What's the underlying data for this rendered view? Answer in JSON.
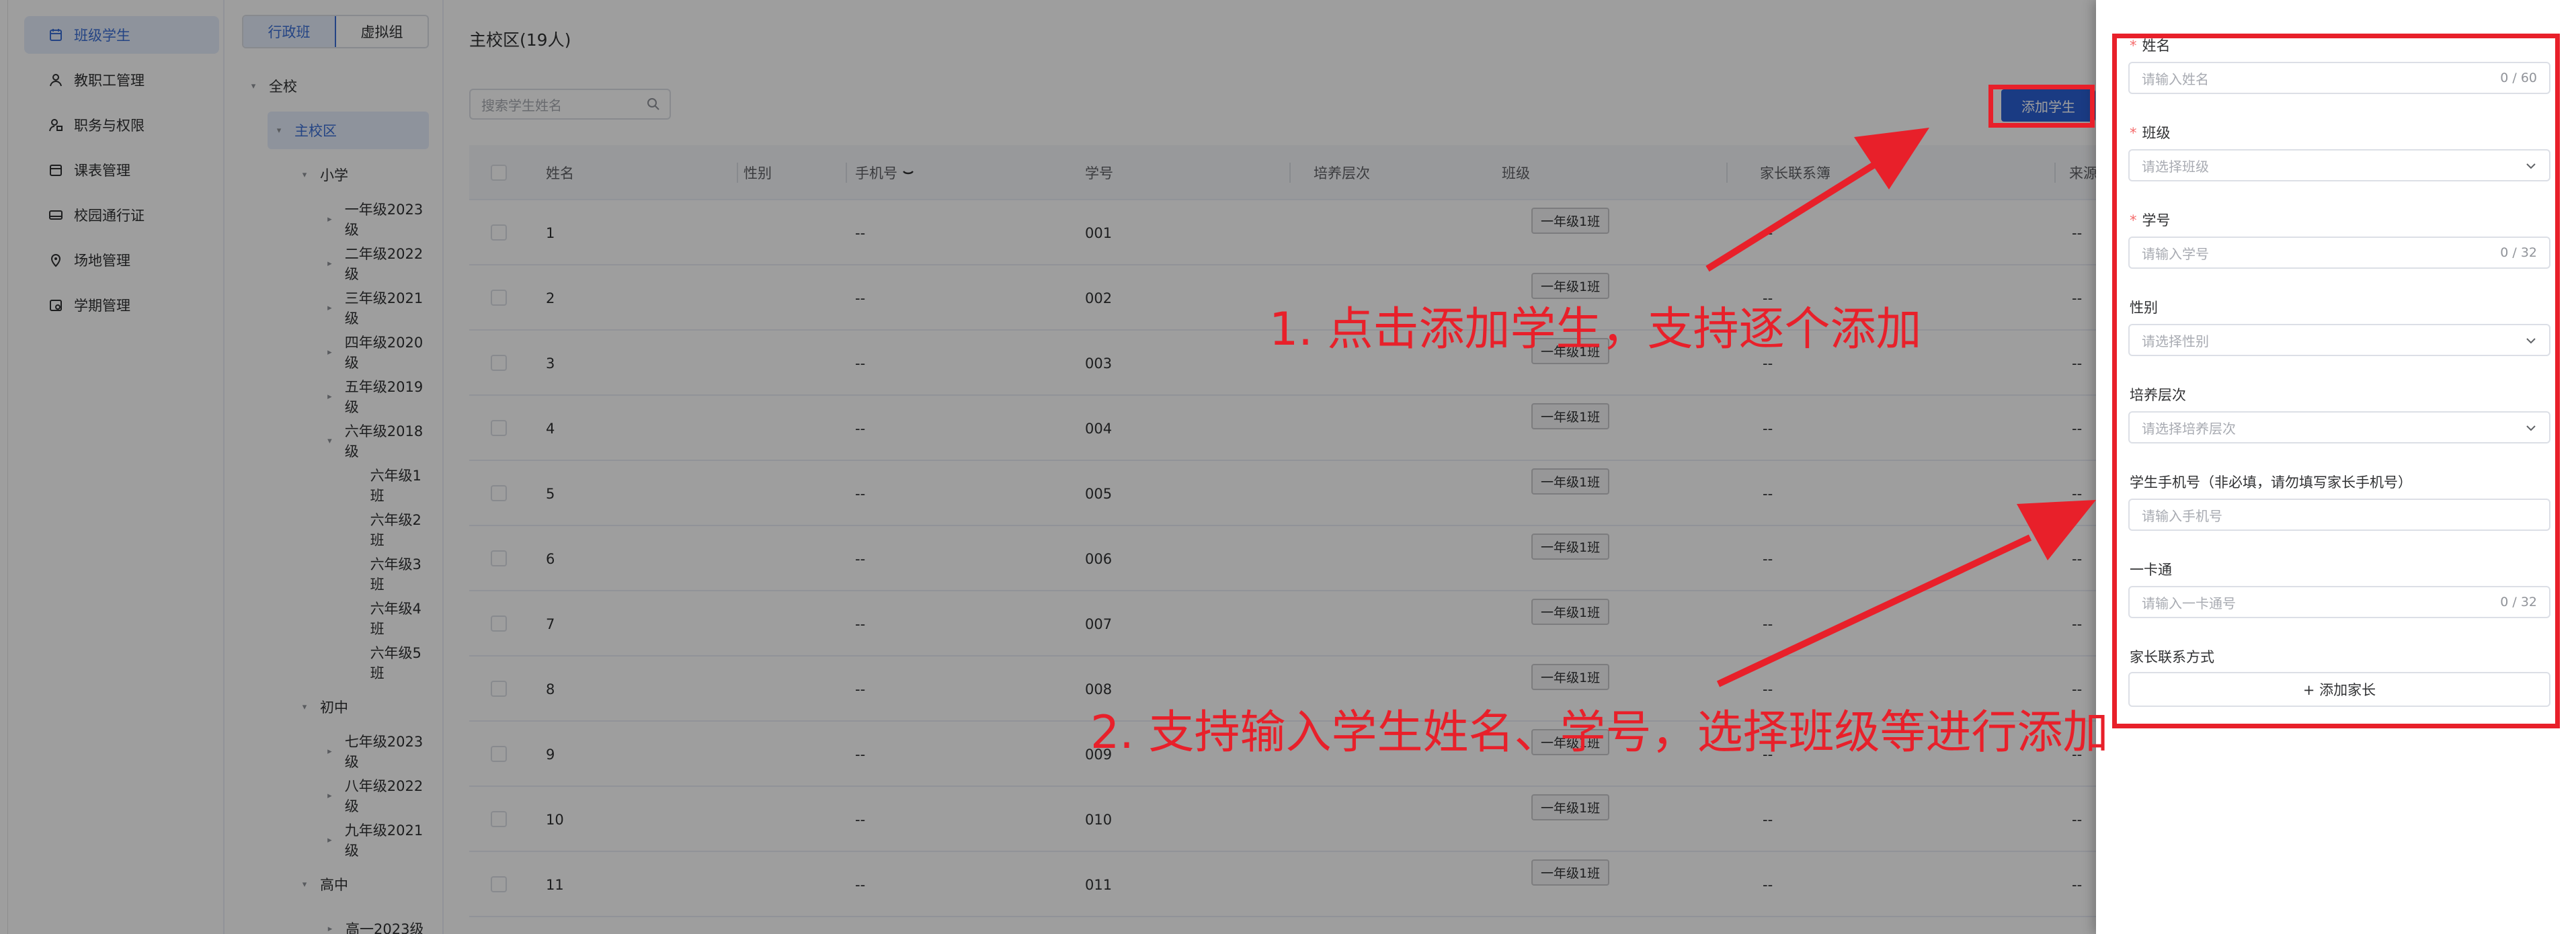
{
  "nav": {
    "items": [
      {
        "label": "班级学生",
        "icon": "class-students-icon",
        "active": true
      },
      {
        "label": "教职工管理",
        "icon": "staff-icon"
      },
      {
        "label": "职务与权限",
        "icon": "role-permission-icon"
      },
      {
        "label": "课表管理",
        "icon": "calendar-icon"
      },
      {
        "label": "校园通行证",
        "icon": "pass-card-icon"
      },
      {
        "label": "场地管理",
        "icon": "location-pin-icon"
      },
      {
        "label": "学期管理",
        "icon": "term-calendar-icon"
      }
    ]
  },
  "tree": {
    "tabs": [
      "行政班",
      "虚拟组"
    ],
    "nodes": [
      {
        "label": "全校",
        "caret": "▾"
      },
      {
        "label": "主校区",
        "caret": "▾",
        "selected": true
      },
      {
        "label": "小学",
        "caret": "▾"
      },
      {
        "label": "一年级2023级",
        "caret": "▸"
      },
      {
        "label": "二年级2022级",
        "caret": "▸"
      },
      {
        "label": "三年级2021级",
        "caret": "▸"
      },
      {
        "label": "四年级2020级",
        "caret": "▸"
      },
      {
        "label": "五年级2019级",
        "caret": "▸"
      },
      {
        "label": "六年级2018级",
        "caret": "▾"
      },
      {
        "label": "六年级1班",
        "caret": ""
      },
      {
        "label": "六年级2班",
        "caret": ""
      },
      {
        "label": "六年级3班",
        "caret": ""
      },
      {
        "label": "六年级4班",
        "caret": ""
      },
      {
        "label": "六年级5班",
        "caret": ""
      },
      {
        "label": "初中",
        "caret": "▾"
      },
      {
        "label": "七年级2023级",
        "caret": "▸"
      },
      {
        "label": "八年级2022级",
        "caret": "▸"
      },
      {
        "label": "九年级2021级",
        "caret": "▸"
      },
      {
        "label": "高中",
        "caret": "▾"
      },
      {
        "label": "高一2023级",
        "caret": "▸"
      }
    ]
  },
  "main": {
    "title": "主校区(19人)",
    "search_placeholder": "搜索学生姓名",
    "add_button": "添加学生",
    "columns": [
      "姓名",
      "性别",
      "手机号",
      "学号",
      "培养层次",
      "班级",
      "家长联系簿",
      "来源"
    ],
    "rows": [
      {
        "name": "1",
        "phone": "--",
        "id": "001",
        "class": "一年级1班",
        "parent": "--",
        "source": "--"
      },
      {
        "name": "2",
        "phone": "--",
        "id": "002",
        "class": "一年级1班",
        "parent": "--",
        "source": "--"
      },
      {
        "name": "3",
        "phone": "--",
        "id": "003",
        "class": "一年级1班",
        "parent": "--",
        "source": "--"
      },
      {
        "name": "4",
        "phone": "--",
        "id": "004",
        "class": "一年级1班",
        "parent": "--",
        "source": "--"
      },
      {
        "name": "5",
        "phone": "--",
        "id": "005",
        "class": "一年级1班",
        "parent": "--",
        "source": "--"
      },
      {
        "name": "6",
        "phone": "--",
        "id": "006",
        "class": "一年级1班",
        "parent": "--",
        "source": "--"
      },
      {
        "name": "7",
        "phone": "--",
        "id": "007",
        "class": "一年级1班",
        "parent": "--",
        "source": "--"
      },
      {
        "name": "8",
        "phone": "--",
        "id": "008",
        "class": "一年级1班",
        "parent": "--",
        "source": "--"
      },
      {
        "name": "9",
        "phone": "--",
        "id": "009",
        "class": "一年级1班",
        "parent": "--",
        "source": "--"
      },
      {
        "name": "10",
        "phone": "--",
        "id": "010",
        "class": "一年级1班",
        "parent": "--",
        "source": "--"
      },
      {
        "name": "11",
        "phone": "--",
        "id": "011",
        "class": "一年级1班",
        "parent": "--",
        "source": "--"
      }
    ]
  },
  "drawer": {
    "name_label": "姓名",
    "name_placeholder": "请输入姓名",
    "name_count": "0 / 60",
    "class_label": "班级",
    "class_placeholder": "请选择班级",
    "sid_label": "学号",
    "sid_placeholder": "请输入学号",
    "sid_count": "0 / 32",
    "gender_label": "性别",
    "gender_placeholder": "请选择性别",
    "level_label": "培养层次",
    "level_placeholder": "请选择培养层次",
    "phone_label": "学生手机号（非必填，请勿填写家长手机号）",
    "phone_placeholder": "请输入手机号",
    "card_label": "一卡通",
    "card_placeholder": "请输入一卡通号",
    "card_count": "0 / 32",
    "parent_label": "家长联系方式",
    "add_parent": "+ 添加家长"
  },
  "annotations": {
    "step1": "1. 点击添加学生，支持逐个添加",
    "step2": "2. 支持输入学生姓名、学号，选择班级等进行添加",
    "color": "#e8202a"
  }
}
